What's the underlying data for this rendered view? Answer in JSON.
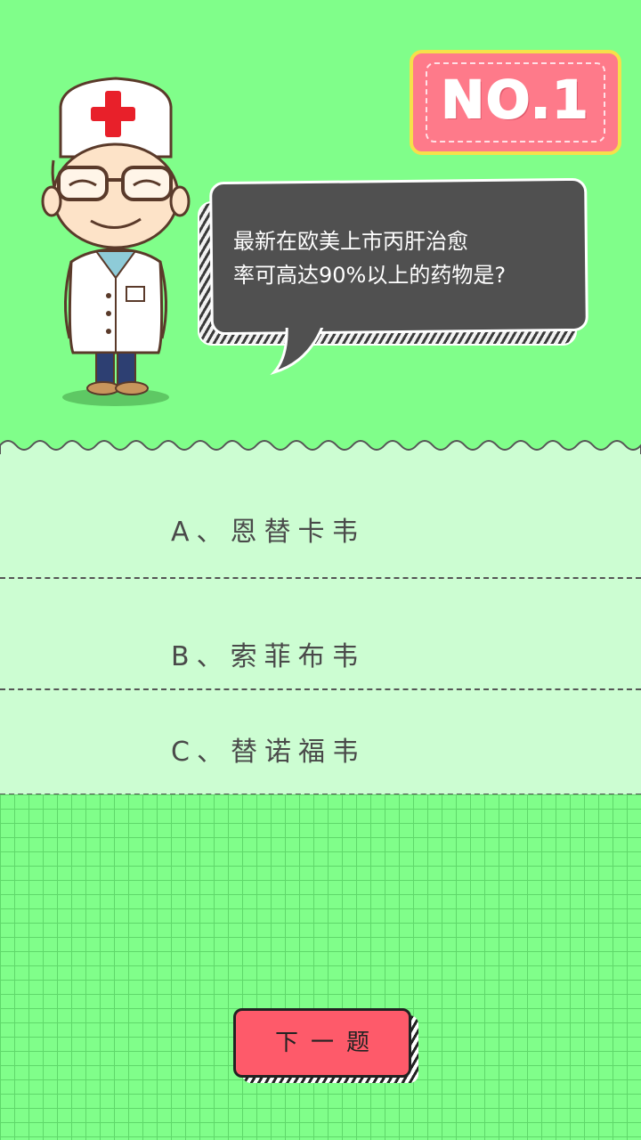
{
  "badge": {
    "text": "NO.1"
  },
  "question": {
    "line1": "最新在欧美上市丙肝治愈",
    "line2": "率可高达90%以上的药物是?"
  },
  "options": [
    {
      "label": "A、恩替卡韦"
    },
    {
      "label": "B、索菲布韦"
    },
    {
      "label": "C、替诺福韦"
    }
  ],
  "next_button": {
    "label": "下一题"
  },
  "colors": {
    "background": "#80fe8a",
    "option_background": "#ccfdd2",
    "badge_fill": "#fe7a8a",
    "badge_border": "#f6e04a",
    "bubble_fill": "#505050",
    "button_fill": "#fe5a6a"
  },
  "icons": {
    "doctor": "doctor-illustration",
    "red_cross": "red-cross-icon"
  }
}
